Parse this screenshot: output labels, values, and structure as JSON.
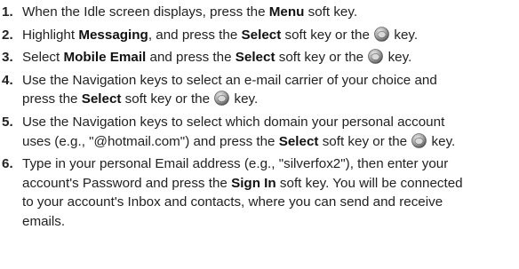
{
  "steps": [
    {
      "number": "1.",
      "lines": [
        {
          "pre": "When the Idle screen displays, press the ",
          "bold1": "Menu",
          "mid1": " soft key.",
          "bold2": "",
          "post": ""
        }
      ]
    },
    {
      "number": "2.",
      "lines": [
        {
          "pre": "Highlight ",
          "bold1": "Messaging",
          "mid1": ", and press the ",
          "bold2": "Select",
          "post": " soft key or the",
          "icon": "select-key-icon",
          "tail": " key."
        }
      ]
    },
    {
      "number": "3.",
      "lines": [
        {
          "pre": "Select ",
          "bold1": "Mobile Email",
          "mid1": " and press the ",
          "bold2": "Select",
          "post": " soft key or the",
          "icon": "select-key-icon",
          "tail": " key."
        }
      ]
    },
    {
      "number": "4.",
      "lines": [
        {
          "pre": "Use the Navigation keys to select an e-mail carrier of your choice and",
          "bold1": "",
          "mid1": "",
          "bold2": "",
          "post": ""
        },
        {
          "pre": "press the ",
          "bold1": "Select",
          "mid1": " soft key or the",
          "bold2": "",
          "post": "",
          "icon": "select-key-icon",
          "tail": " key."
        }
      ]
    },
    {
      "number": "5.",
      "lines": [
        {
          "pre": "Use the Navigation keys to select which domain your personal account",
          "bold1": "",
          "mid1": "",
          "bold2": "",
          "post": ""
        },
        {
          "pre": "uses (e.g., \"@hotmail.com\") and press the ",
          "bold1": "Select",
          "mid1": " soft key or the",
          "bold2": "",
          "post": "",
          "icon": "select-key-icon",
          "tail": " key."
        }
      ]
    },
    {
      "number": "6.",
      "lines": [
        {
          "pre": "Type in your personal Email address (e.g., \"silverfox2\"), then enter your",
          "bold1": "",
          "mid1": "",
          "bold2": "",
          "post": ""
        },
        {
          "pre": "account's Password and press the ",
          "bold1": "Sign In",
          "mid1": " soft key. You will be connected",
          "bold2": "",
          "post": ""
        },
        {
          "pre": "to your account's Inbox and contacts, where you can send and receive",
          "bold1": "",
          "mid1": "",
          "bold2": "",
          "post": ""
        },
        {
          "pre": "emails.",
          "bold1": "",
          "mid1": "",
          "bold2": "",
          "post": ""
        }
      ]
    }
  ]
}
